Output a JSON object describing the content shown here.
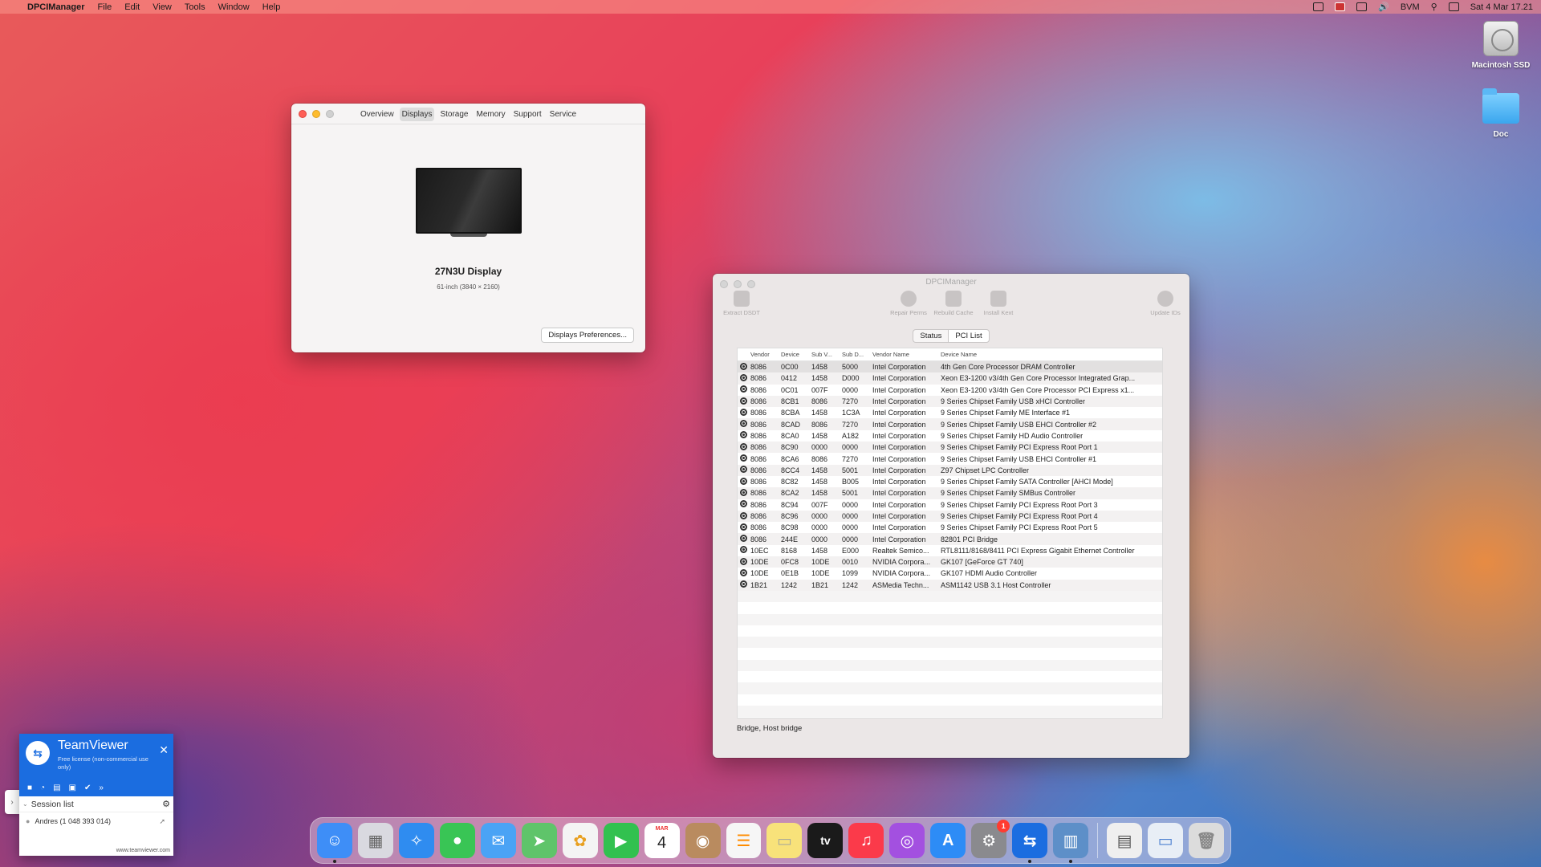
{
  "menubar": {
    "apple": "",
    "app_name": "DPCIManager",
    "menus": [
      "File",
      "Edit",
      "View",
      "Tools",
      "Window",
      "Help"
    ],
    "user": "BVM",
    "datetime": "Sat 4 Mar  17.21"
  },
  "desktop": {
    "icons": [
      {
        "label": "Macintosh SSD",
        "icon": "hard-drive-icon"
      },
      {
        "label": "Doc",
        "icon": "folder-icon"
      }
    ]
  },
  "about_window": {
    "tabs": [
      "Overview",
      "Displays",
      "Storage",
      "Memory",
      "Support",
      "Service"
    ],
    "active_tab": "Displays",
    "display_name": "27N3U Display",
    "display_spec": "61-inch (3840 × 2160)",
    "prefs_button": "Displays Preferences..."
  },
  "dpci_window": {
    "title": "DPCIManager",
    "toolbar": [
      "Extract DSDT",
      "Repair Perms",
      "Rebuild Cache",
      "Install Kext",
      "Update IDs"
    ],
    "segments": [
      "Status",
      "PCI List"
    ],
    "active_segment": "PCI List",
    "columns": [
      "",
      "Vendor",
      "Device",
      "Sub V...",
      "Sub D...",
      "Vendor Name",
      "Device Name"
    ],
    "rows": [
      [
        "8086",
        "0C00",
        "1458",
        "5000",
        "Intel Corporation",
        "4th Gen Core Processor DRAM Controller"
      ],
      [
        "8086",
        "0412",
        "1458",
        "D000",
        "Intel Corporation",
        "Xeon E3-1200 v3/4th Gen Core Processor Integrated Grap..."
      ],
      [
        "8086",
        "0C01",
        "007F",
        "0000",
        "Intel Corporation",
        "Xeon E3-1200 v3/4th Gen Core Processor PCI Express x1..."
      ],
      [
        "8086",
        "8CB1",
        "8086",
        "7270",
        "Intel Corporation",
        "9 Series Chipset Family USB xHCI Controller"
      ],
      [
        "8086",
        "8CBA",
        "1458",
        "1C3A",
        "Intel Corporation",
        "9 Series Chipset Family ME Interface #1"
      ],
      [
        "8086",
        "8CAD",
        "8086",
        "7270",
        "Intel Corporation",
        "9 Series Chipset Family USB EHCI Controller #2"
      ],
      [
        "8086",
        "8CA0",
        "1458",
        "A182",
        "Intel Corporation",
        "9 Series Chipset Family HD Audio Controller"
      ],
      [
        "8086",
        "8C90",
        "0000",
        "0000",
        "Intel Corporation",
        "9 Series Chipset Family PCI Express Root Port 1"
      ],
      [
        "8086",
        "8CA6",
        "8086",
        "7270",
        "Intel Corporation",
        "9 Series Chipset Family USB EHCI Controller #1"
      ],
      [
        "8086",
        "8CC4",
        "1458",
        "5001",
        "Intel Corporation",
        "Z97 Chipset LPC Controller"
      ],
      [
        "8086",
        "8C82",
        "1458",
        "B005",
        "Intel Corporation",
        "9 Series Chipset Family SATA Controller [AHCI Mode]"
      ],
      [
        "8086",
        "8CA2",
        "1458",
        "5001",
        "Intel Corporation",
        "9 Series Chipset Family SMBus Controller"
      ],
      [
        "8086",
        "8C94",
        "007F",
        "0000",
        "Intel Corporation",
        "9 Series Chipset Family PCI Express Root Port 3"
      ],
      [
        "8086",
        "8C96",
        "0000",
        "0000",
        "Intel Corporation",
        "9 Series Chipset Family PCI Express Root Port 4"
      ],
      [
        "8086",
        "8C98",
        "0000",
        "0000",
        "Intel Corporation",
        "9 Series Chipset Family PCI Express Root Port 5"
      ],
      [
        "8086",
        "244E",
        "0000",
        "0000",
        "Intel Corporation",
        "82801 PCI Bridge"
      ],
      [
        "10EC",
        "8168",
        "1458",
        "E000",
        "Realtek Semico...",
        "RTL8111/8168/8411 PCI Express Gigabit Ethernet Controller"
      ],
      [
        "10DE",
        "0FC8",
        "10DE",
        "0010",
        "NVIDIA Corpora...",
        "GK107 [GeForce GT 740]"
      ],
      [
        "10DE",
        "0E1B",
        "10DE",
        "1099",
        "NVIDIA Corpora...",
        "GK107 HDMI Audio Controller"
      ],
      [
        "1B21",
        "1242",
        "1B21",
        "1242",
        "ASMedia Techn...",
        "ASM1142 USB 3.1 Host Controller"
      ]
    ],
    "status_text": "Bridge, Host bridge"
  },
  "teamviewer": {
    "name": "TeamViewer",
    "license": "Free license (non-commercial use only)",
    "session_list": "Session list",
    "user": "Andres (1 048 393 014)",
    "footer": "www.teamviewer.com"
  },
  "dock": {
    "calendar_month": "MAR",
    "calendar_day": "4",
    "tv_label": "tv",
    "settings_badge": "1",
    "colors": {
      "finder": "#3e8ef7",
      "launchpad": "#d9d9e0",
      "safari": "#2f8cf0",
      "messages": "#39c555",
      "mail": "#4aa3f5",
      "maps": "#5fc46a",
      "photos": "#f4f4f4",
      "facetime": "#32c14f",
      "calendar": "#ffffff",
      "contacts": "#b98b5f",
      "reminders": "#f6f6f6",
      "notes": "#f8e27a",
      "tv": "#1a1a1a",
      "music": "#fb3a4a",
      "podcasts": "#a350e0",
      "appstore": "#2d8cf6",
      "settings": "#8a8a8e",
      "teamviewer": "#1b6de0",
      "dpci": "#5d8fc8",
      "doc": "#efefef",
      "screenshot": "#e8eef6",
      "trash": "#dcdcdc"
    }
  }
}
